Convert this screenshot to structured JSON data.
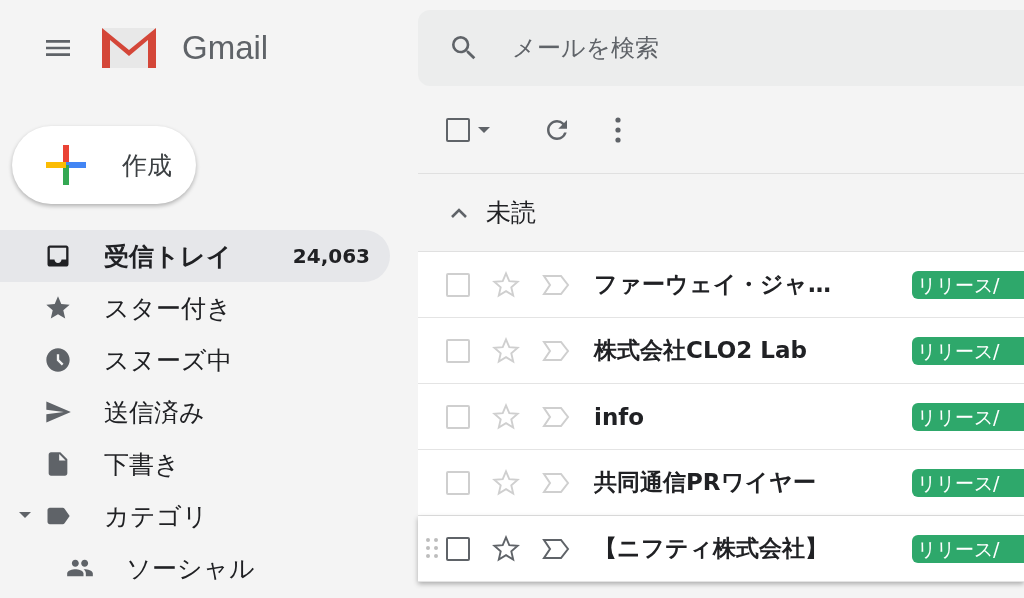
{
  "header": {
    "logo_text": "Gmail"
  },
  "search": {
    "placeholder": "メールを検索"
  },
  "compose": {
    "label": "作成"
  },
  "nav": [
    {
      "label": "受信トレイ",
      "count": "24,063",
      "selected": true
    },
    {
      "label": "スター付き",
      "selected": false
    },
    {
      "label": "スヌーズ中",
      "selected": false
    },
    {
      "label": "送信済み",
      "selected": false
    },
    {
      "label": "下書き",
      "selected": false
    },
    {
      "label": "カテゴリ",
      "selected": false,
      "expanded": true,
      "children": [
        {
          "label": "ソーシャル",
          "selected": false
        }
      ]
    }
  ],
  "toolbar": {
    "select_all_checked": false
  },
  "section": {
    "title": "未読",
    "expanded": true
  },
  "emails": [
    {
      "sender": "ファーウェイ・ジャ…",
      "tag": "リリース/",
      "color": "#2ea86b",
      "unread": true,
      "checked": false,
      "starred": false,
      "hovered": false
    },
    {
      "sender": "株式会社CLO2 Lab",
      "tag": "リリース/",
      "color": "#2ea86b",
      "unread": true,
      "checked": false,
      "starred": false,
      "hovered": false
    },
    {
      "sender": "info",
      "tag": "リリース/",
      "color": "#2ea86b",
      "unread": true,
      "checked": false,
      "starred": false,
      "hovered": false
    },
    {
      "sender": "共同通信PRワイヤー",
      "tag": "リリース/",
      "color": "#2ea86b",
      "unread": true,
      "checked": false,
      "starred": false,
      "hovered": false
    },
    {
      "sender": "【ニフティ株式会社】",
      "tag": "リリース/",
      "color": "#2ea86b",
      "unread": true,
      "checked": false,
      "starred": false,
      "hovered": true
    }
  ]
}
